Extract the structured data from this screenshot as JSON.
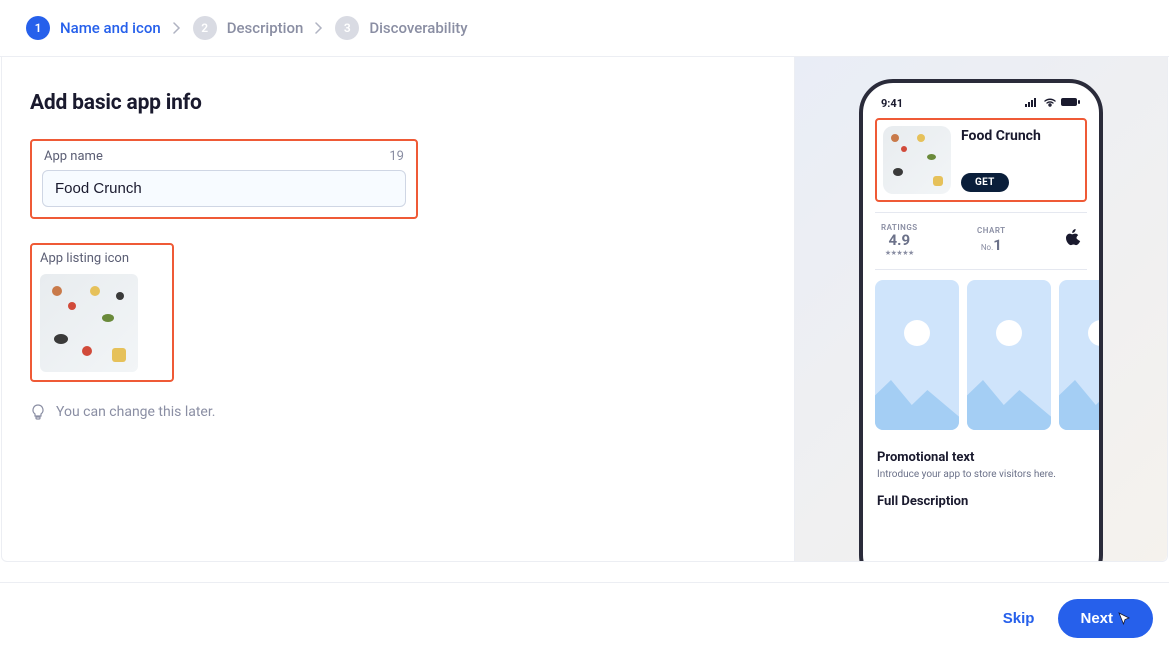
{
  "stepper": {
    "steps": [
      {
        "num": "1",
        "label": "Name and icon",
        "active": true
      },
      {
        "num": "2",
        "label": "Description",
        "active": false
      },
      {
        "num": "3",
        "label": "Discoverability",
        "active": false
      }
    ]
  },
  "page": {
    "title": "Add basic app info"
  },
  "form": {
    "appName": {
      "label": "App name",
      "charsRemaining": "19",
      "value": "Food Crunch"
    },
    "appIcon": {
      "label": "App listing icon",
      "iconName": "food-picnic-icon"
    },
    "hint": "You can change this later."
  },
  "preview": {
    "statusTime": "9:41",
    "appTitle": "Food Crunch",
    "getLabel": "GET",
    "ratings": {
      "label": "RATINGS",
      "value": "4.9",
      "stars": "★★★★★"
    },
    "chart": {
      "label": "CHART",
      "prefix": "No.",
      "value": "1"
    },
    "promotional": {
      "title": "Promotional text",
      "subtitle": "Introduce your app to store visitors here."
    },
    "fullDescription": "Full Description"
  },
  "footer": {
    "skip": "Skip",
    "next": "Next"
  }
}
